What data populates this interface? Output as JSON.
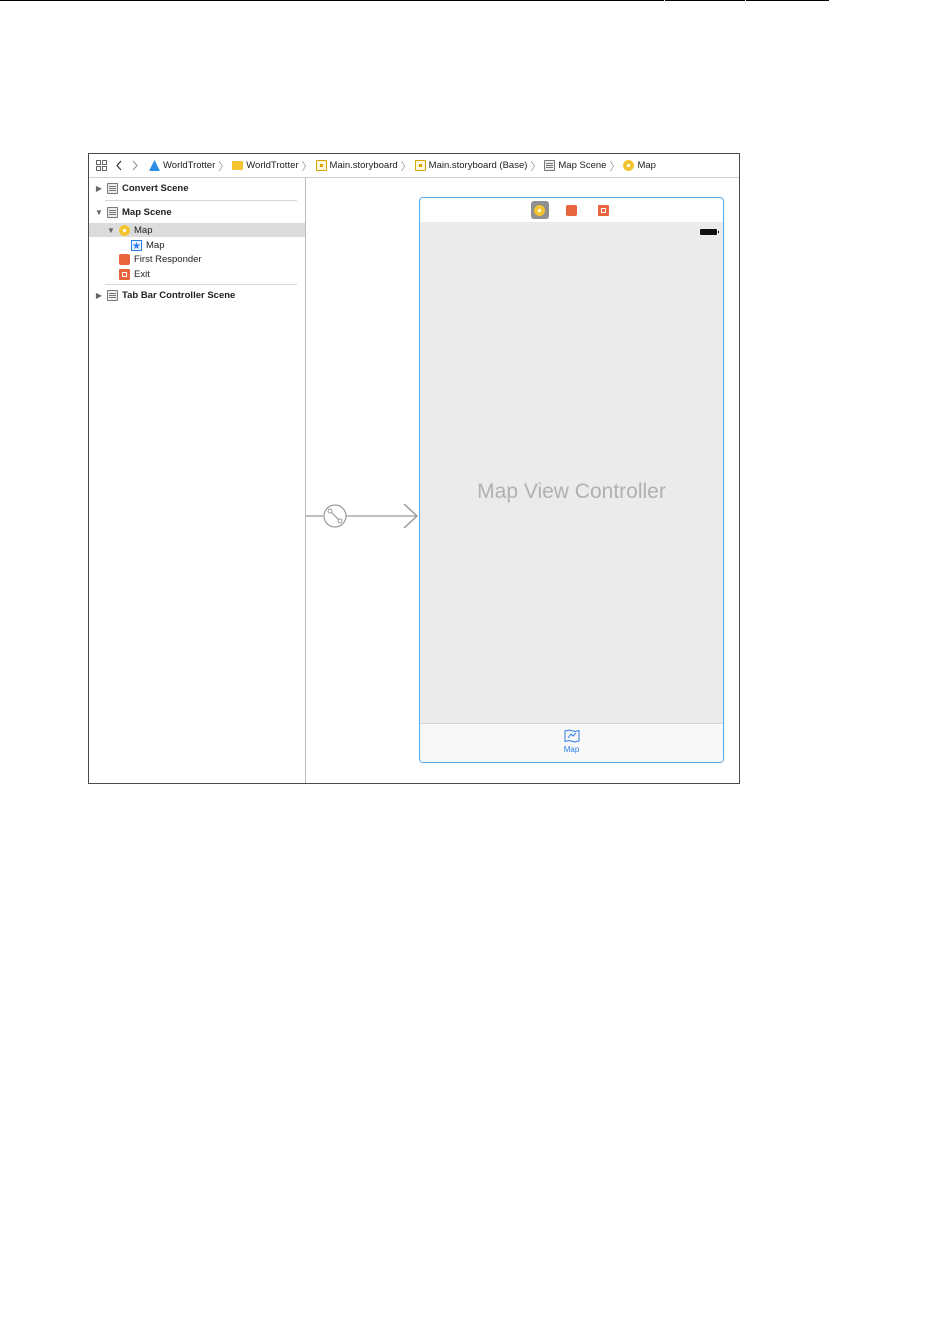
{
  "jump_bar": {
    "crumbs": [
      {
        "label": "WorldTrotter",
        "icon": "project-icon"
      },
      {
        "label": "WorldTrotter",
        "icon": "folder-icon"
      },
      {
        "label": "Main.storyboard",
        "icon": "storyboard-icon"
      },
      {
        "label": "Main.storyboard (Base)",
        "icon": "storyboard-icon"
      },
      {
        "label": "Map Scene",
        "icon": "scene-icon"
      },
      {
        "label": "Map",
        "icon": "view-controller-icon"
      }
    ]
  },
  "outline": {
    "convert_scene": "Convert Scene",
    "map_scene": "Map Scene",
    "map_vc": "Map",
    "map_tab_item": "Map",
    "first_responder": "First Responder",
    "exit": "Exit",
    "tab_bar_scene": "Tab Bar Controller Scene"
  },
  "canvas": {
    "view_controller_title": "Map View Controller",
    "tab_item_label": "Map"
  },
  "colors": {
    "selection_blue": "#5aa9e6",
    "accent_blue": "#2b7de9",
    "vc_yellow": "#f4c430",
    "responder_orange": "#e8643a"
  }
}
